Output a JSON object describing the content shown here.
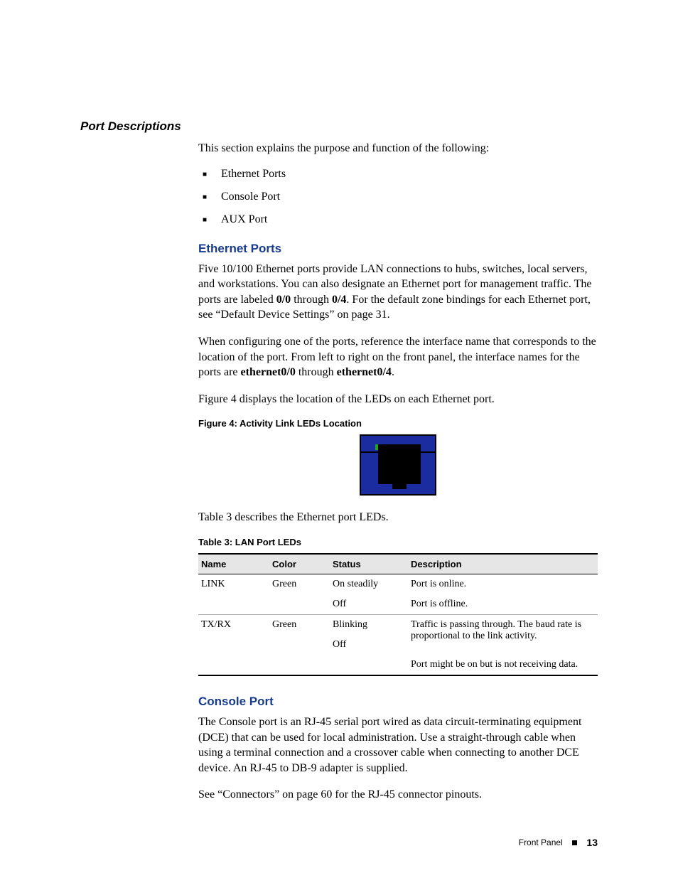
{
  "section_title": "Port Descriptions",
  "intro": "This section explains the purpose and function of the following:",
  "bullets": [
    "Ethernet Ports",
    "Console Port",
    "AUX Port"
  ],
  "ethernet": {
    "heading": "Ethernet Ports",
    "p1a": "Five 10/100 Ethernet ports provide LAN connections to hubs, switches, local servers, and workstations. You can also designate an Ethernet port for management traffic. The ports are labeled ",
    "p1b": "0/0",
    "p1c": " through ",
    "p1d": "0/4",
    "p1e": ". For the default zone bindings for each Ethernet port, see “Default Device Settings” on page 31.",
    "p2a": "When configuring one of the ports, reference the interface name that corresponds to the location of the port. From left to right on the front panel, the interface names for the ports are ",
    "p2b": "ethernet0/0",
    "p2c": " through ",
    "p2d": "ethernet0/4",
    "p2e": ".",
    "p3": "Figure 4 displays the location of the LEDs on each Ethernet port.",
    "fig_caption": "Figure 4:  Activity Link LEDs Location",
    "p4": "Table 3 describes the Ethernet port LEDs.",
    "tbl_caption": "Table 3:  LAN Port LEDs"
  },
  "table": {
    "headers": [
      "Name",
      "Color",
      "Status",
      "Description"
    ],
    "rows": [
      {
        "name": "LINK",
        "color": "Green",
        "status": "On steadily",
        "desc": "Port is online."
      },
      {
        "name": "",
        "color": "",
        "status": "Off",
        "desc": "Port is offline."
      },
      {
        "name": "TX/RX",
        "color": "Green",
        "status": "Blinking",
        "desc": "Traffic is passing through. The baud rate is proportional to the link activity."
      },
      {
        "name": "",
        "color": "",
        "status": "Off",
        "desc": ""
      },
      {
        "name": "",
        "color": "",
        "status": "",
        "desc": "Port might be on but is not receiving data."
      }
    ]
  },
  "console": {
    "heading": "Console Port",
    "p1": "The Console port is an RJ-45 serial port wired as data circuit-terminating equipment (DCE) that can be used for local administration. Use a straight-through cable when using a terminal connection and a crossover cable when connecting to another DCE device. An RJ-45 to DB-9 adapter is supplied.",
    "p2": "See “Connectors” on page 60 for the RJ-45 connector pinouts."
  },
  "footer": {
    "text": "Front Panel",
    "page": "13"
  }
}
